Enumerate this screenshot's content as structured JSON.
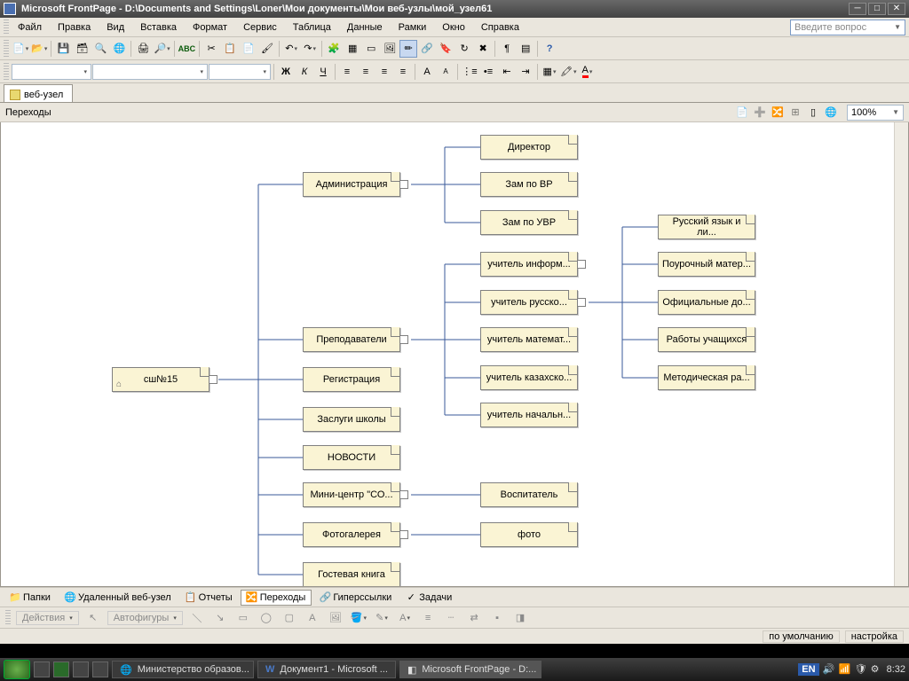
{
  "title": "Microsoft FrontPage - D:\\Documents and Settings\\Loner\\Мои документы\\Мои веб-узлы\\мой_узел61",
  "menus": [
    "Файл",
    "Правка",
    "Вид",
    "Вставка",
    "Формат",
    "Сервис",
    "Таблица",
    "Данные",
    "Рамки",
    "Окно",
    "Справка"
  ],
  "question_placeholder": "Введите вопрос",
  "doc_tab": "веб-узел",
  "subbar_label": "Переходы",
  "zoom": "100%",
  "view_tabs": [
    {
      "label": "Папки",
      "icon": "📁"
    },
    {
      "label": "Удаленный веб-узел",
      "icon": "🌐"
    },
    {
      "label": "Отчеты",
      "icon": "📄"
    },
    {
      "label": "Переходы",
      "icon": "🔀",
      "active": true
    },
    {
      "label": "Гиперссылки",
      "icon": "🔗"
    },
    {
      "label": "Задачи",
      "icon": "✓"
    }
  ],
  "action_bar": {
    "actions": "Действия",
    "autoshapes": "Автофигуры"
  },
  "status": {
    "default": "по умолчанию",
    "setup": "настройка"
  },
  "taskbar": {
    "items": [
      {
        "label": "Министерство образов...",
        "icon": "🌐"
      },
      {
        "label": "Документ1 - Microsoft ...",
        "icon": "W"
      },
      {
        "label": "Microsoft FrontPage - D:...",
        "icon": "◧",
        "active": true
      }
    ],
    "lang": "EN",
    "clock": "8:32"
  },
  "nodes": {
    "root": "сш№15",
    "l1": [
      "Администрация",
      "Преподаватели",
      "Регистрация",
      "Заслуги школы",
      "НОВОСТИ",
      "Мини-центр \"СО...",
      "Фотогалерея",
      "Гостевая книга"
    ],
    "admin_children": [
      "Директор",
      "Зам по ВР",
      "Зам по УВР"
    ],
    "teach_children": [
      "учитель информ...",
      "учитель русско...",
      "учитель математ...",
      "учитель казахско...",
      "учитель начальн..."
    ],
    "mini_children": [
      "Воспитатель"
    ],
    "photo_children": [
      "фото"
    ],
    "rus_children": [
      "Русский язык и ли...",
      "Поурочный матер...",
      "Официальные до...",
      "Работы учащихся",
      "Методическая ра..."
    ]
  }
}
